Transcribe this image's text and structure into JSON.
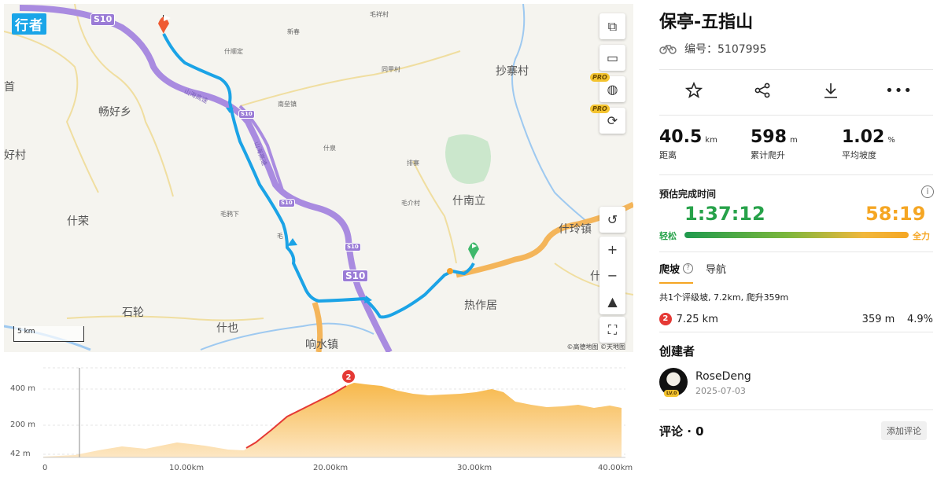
{
  "map": {
    "logo": "行者",
    "places": {
      "changhao": "畅好乡",
      "chaozhai": "抄寨村",
      "shirong": "什荣",
      "shinanli": "什南立",
      "shilingzhen": "什玲镇",
      "rezuoju": "热作居",
      "shilun": "石轮",
      "shihe": "什也",
      "xiangshuizhen": "响水镇",
      "haocun": "好村",
      "xinchun": "新春",
      "shixian": "什顺定",
      "maoxiang": "毛祥村",
      "tongsheng": "同甲村",
      "nanxian": "南垒镇",
      "shiquan": "什泉",
      "paizhai": "排寨",
      "maojie": "毛介村",
      "maoye": "毛鸦下",
      "mao2": "毛",
      "shanhai": "山海高速",
      "shanhai2": "山海高速",
      "shou": "首",
      "shi_edge": "什"
    },
    "shield_main": "S10",
    "shield_top": "S10",
    "shield_small": "S10",
    "shield_small2": "S10",
    "shield_mid": "S10",
    "pro1": "PRO",
    "pro2": "PRO",
    "scale": "5 km",
    "credits": "©高德地图 ©天地图"
  },
  "elevation": {
    "y_labels": [
      "400 m",
      "200 m",
      "42 m"
    ],
    "x_labels": [
      "0",
      "10.00km",
      "20.00km",
      "30.00km",
      "40.00km"
    ],
    "marker": "2"
  },
  "route": {
    "title": "保亭-五指山",
    "id_label": "编号：5107995",
    "stats": [
      {
        "value": "40.5",
        "unit": "km",
        "label": "距离"
      },
      {
        "value": "598",
        "unit": "m",
        "label": "累计爬升"
      },
      {
        "value": "1.02",
        "unit": "%",
        "label": "平均坡度"
      }
    ],
    "estimate_title": "预估完成时间",
    "time_easy": "1:37:12",
    "time_full": "58:19",
    "label_easy": "轻松",
    "label_full": "全力",
    "tab_climb": "爬坡",
    "tab_nav": "导航",
    "summary": "共1个评级坡, 7.2km, 爬升359m",
    "climb": {
      "cat": "2",
      "distance": "7.25 km",
      "gain": "359 m",
      "grade": "4.9%"
    },
    "creator_title": "创建者",
    "creator_name": "RoseDeng",
    "creator_date": "2025-07-03",
    "creator_level": "LV.0",
    "comments_title": "评论 · 0",
    "add_comment": "添加评论"
  },
  "colors": {
    "route": "#1ba3e6",
    "easy": "#27a24a",
    "full": "#f5a623",
    "highway": "#9a7bd6"
  }
}
